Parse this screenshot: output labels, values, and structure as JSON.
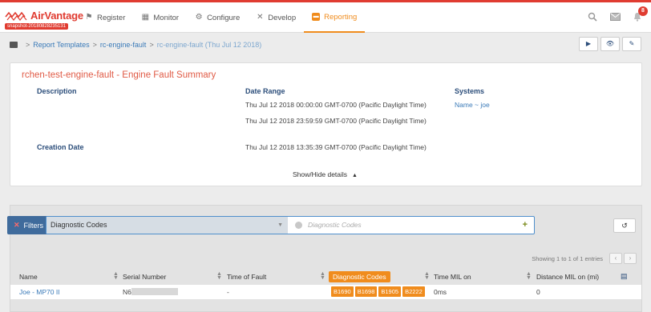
{
  "app": {
    "brand": "AirVantage",
    "snapshot_badge": "snapshot-20180828235131",
    "nav": [
      {
        "label": "Register",
        "icon": "register-icon",
        "glyph": "⚑",
        "active": false
      },
      {
        "label": "Monitor",
        "icon": "monitor-icon",
        "glyph": "▦",
        "active": false
      },
      {
        "label": "Configure",
        "icon": "gear-icon",
        "glyph": "⚙",
        "active": false
      },
      {
        "label": "Develop",
        "icon": "tools-icon",
        "glyph": "✕",
        "active": false
      },
      {
        "label": "Reporting",
        "icon": "reporting-icon",
        "glyph": "▬",
        "active": true
      }
    ],
    "notifications_count": "8",
    "accent": "#e03c31",
    "active_tab_color": "#f08c1d"
  },
  "breadcrumb": {
    "items": [
      "Report Templates",
      "rc-engine-fault"
    ],
    "current": "rc-engine-fault (Thu Jul 12 2018)"
  },
  "actions": [
    "run",
    "view",
    "edit"
  ],
  "summary": {
    "title": "rchen-test-engine-fault - Engine Fault Summary",
    "description_label": "Description",
    "date_range_label": "Date Range",
    "date_start": "Thu Jul 12 2018 00:00:00 GMT-0700 (Pacific Daylight Time)",
    "date_end": "Thu Jul 12 2018 23:59:59 GMT-0700 (Pacific Daylight Time)",
    "systems_label": "Systems",
    "systems_value": "Name ~ joe",
    "creation_label": "Creation Date",
    "creation_value": "Thu Jul 12 2018 13:35:39 GMT-0700 (Pacific Daylight Time)",
    "toggle_label": "Show/Hide details"
  },
  "filters": {
    "label": "Filters",
    "selected": "Diagnostic Codes",
    "placeholder": "Diagnostic Codes",
    "add": "+"
  },
  "table": {
    "showing": "Showing 1 to 1 of 1 entries",
    "columns": [
      "Name",
      "Serial Number",
      "Time of Fault",
      "Diagnostic Codes",
      "Time MIL on",
      "Distance MIL on (mi)"
    ],
    "rows": [
      {
        "name": "Joe - MP70 II",
        "serial": "N6",
        "time_of_fault": "-",
        "codes": [
          "B1690",
          "B1698",
          "B1905",
          "B2222"
        ],
        "time_mil_on": "0ms",
        "distance_mil_on": "0"
      }
    ]
  }
}
